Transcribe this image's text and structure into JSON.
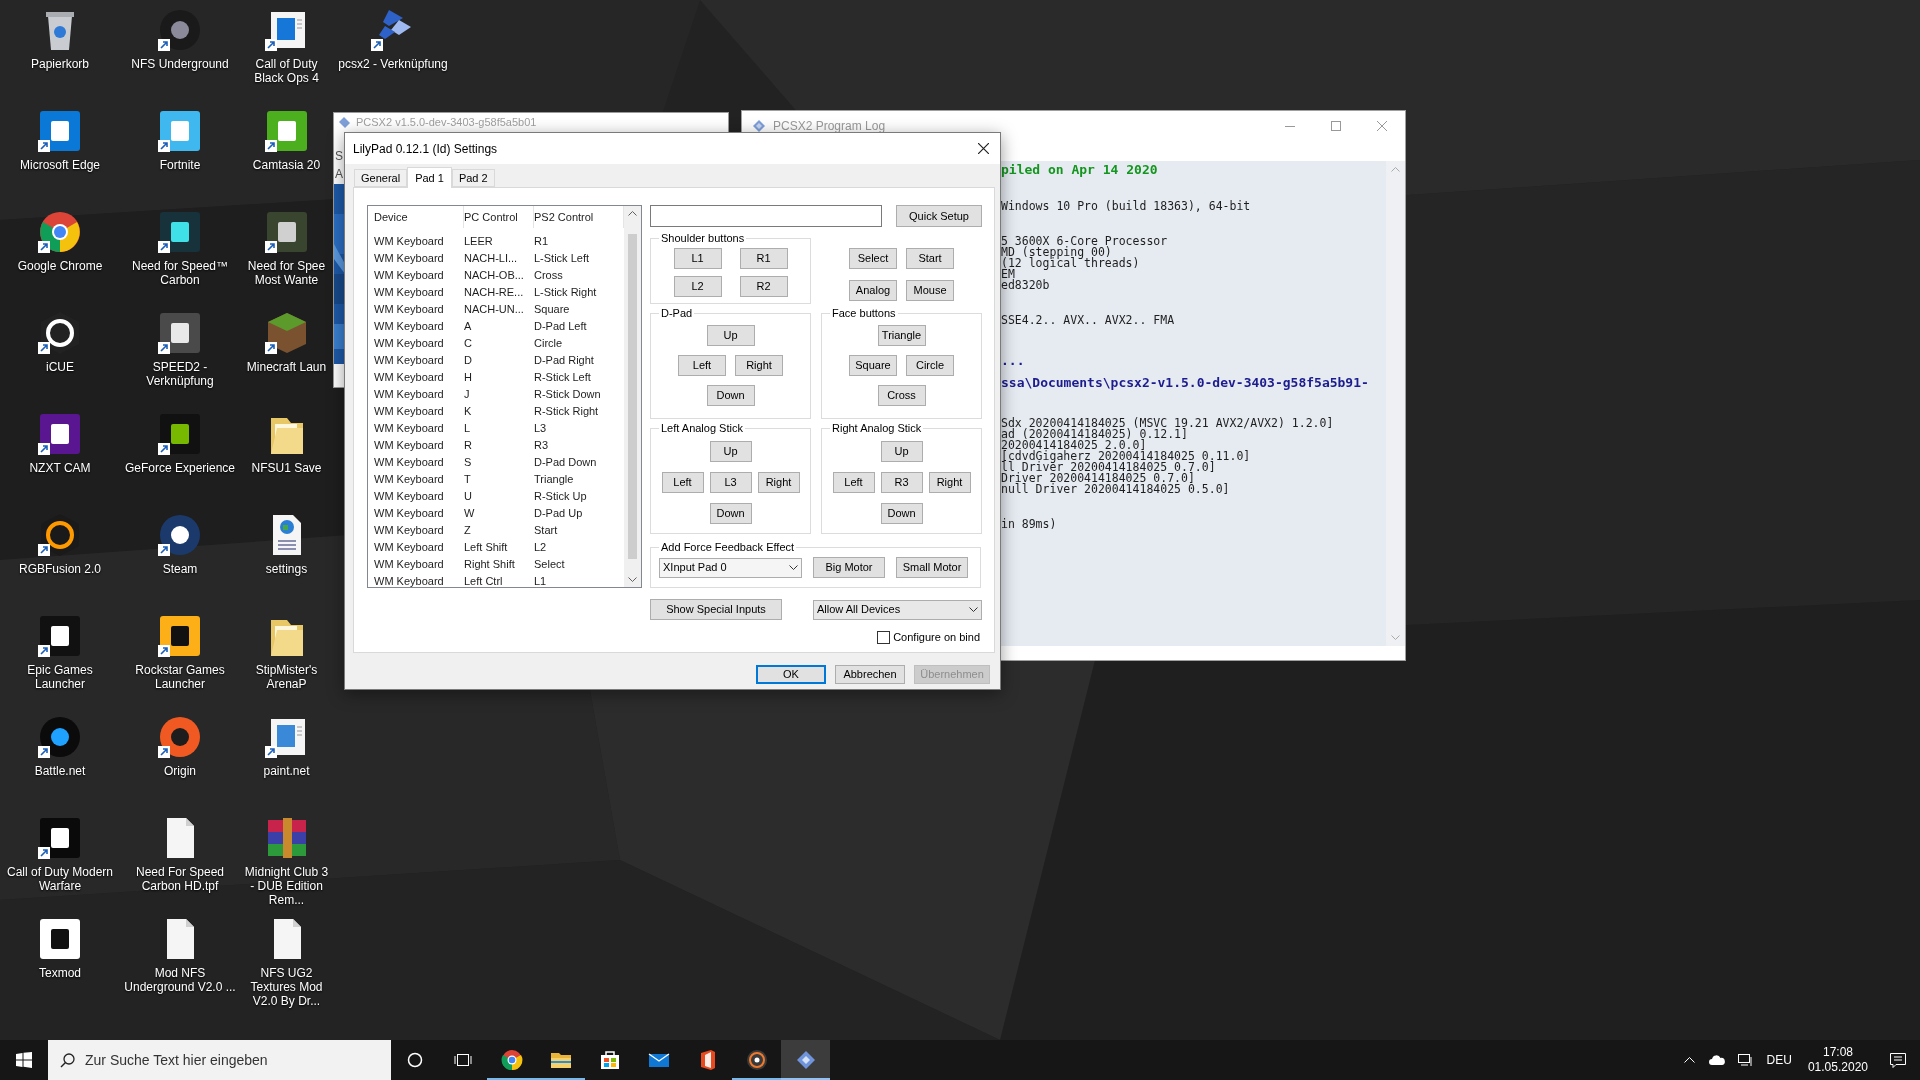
{
  "desktop": {
    "icons": [
      {
        "label": "Papierkorb"
      },
      {
        "label": "Microsoft Edge"
      },
      {
        "label": "Google Chrome"
      },
      {
        "label": "iCUE"
      },
      {
        "label": "NZXT CAM"
      },
      {
        "label": "RGBFusion 2.0"
      },
      {
        "label": "Epic Games Launcher"
      },
      {
        "label": "Battle.net"
      },
      {
        "label": "Call of Duty Modern Warfare"
      },
      {
        "label": "Texmod"
      },
      {
        "label": "NFS Underground"
      },
      {
        "label": "Fortnite"
      },
      {
        "label": "Need for Speed™ Carbon"
      },
      {
        "label": "SPEED2 - Verknüpfung"
      },
      {
        "label": "GeForce Experience"
      },
      {
        "label": "Steam"
      },
      {
        "label": "Rockstar Games Launcher"
      },
      {
        "label": "Origin"
      },
      {
        "label": "Need For Speed Carbon HD.tpf"
      },
      {
        "label": "Mod NFS Underground V2.0 ..."
      },
      {
        "label": "Call of Duty Black Ops 4"
      },
      {
        "label": "Camtasia 20"
      },
      {
        "label": "Need for Spee Most Wante"
      },
      {
        "label": "Minecraft Laun"
      },
      {
        "label": "NFSU1 Save"
      },
      {
        "label": "settings"
      },
      {
        "label": "StipMister's ArenaP"
      },
      {
        "label": "paint.net"
      },
      {
        "label": "Midnight Club 3 - DUB Edition Rem..."
      },
      {
        "label": "NFS UG2 Textures Mod V2.0 By Dr..."
      },
      {
        "label": "pcsx2 - Verknüpfung"
      }
    ]
  },
  "main_window": {
    "title": "PCSX2 v1.5.0-dev-3403-g58f5a5b01",
    "fragments": [
      "S",
      "A"
    ]
  },
  "log_window": {
    "title": "PCSX2 Program Log",
    "blocks": [
      {
        "kind": "highlight",
        "lines": [
          "piled on Apr 14 2020"
        ]
      },
      {
        "kind": "plain",
        "lines": [
          "Windows 10 Pro (build 18363), 64-bit"
        ]
      },
      {
        "kind": "plain",
        "lines": [
          "5 3600X 6-Core Processor",
          "MD (stepping 00)",
          "(12 logical threads)",
          "EM",
          "ed8320b"
        ]
      },
      {
        "kind": "plain",
        "lines": [
          "SSE4.2.. AVX.. AVX2.. FMA"
        ]
      },
      {
        "kind": "section",
        "lines": [
          "...",
          "ssa\\Documents\\pcsx2-v1.5.0-dev-3403-g58f5a5b91-"
        ]
      },
      {
        "kind": "plain",
        "lines": [
          "Sdx 20200414184025 (MSVC 19.21 AVX2/AVX2) 1.2.0]",
          "ad (20200414184025) 0.12.1]",
          "20200414184025 2.0.0]",
          "[cdvdGigaherz 20200414184025 0.11.0]",
          "ll Driver 20200414184025 0.7.0]",
          "Driver 20200414184025 0.7.0]",
          "null Driver 20200414184025 0.5.0]"
        ]
      },
      {
        "kind": "plain",
        "lines": [
          "in 89ms)"
        ]
      }
    ]
  },
  "dialog": {
    "title": "LilyPad 0.12.1 (Id) Settings",
    "tabs": [
      {
        "label": "General",
        "selected": false
      },
      {
        "label": "Pad 1",
        "selected": true
      },
      {
        "label": "Pad 2",
        "selected": false
      }
    ],
    "bindings": {
      "columns": [
        "Device",
        "PC Control",
        "PS2 Control"
      ],
      "rows": [
        [
          "WM Keyboard",
          "LEER",
          "R1"
        ],
        [
          "WM Keyboard",
          "NACH-LI...",
          "L-Stick Left"
        ],
        [
          "WM Keyboard",
          "NACH-OB...",
          "Cross"
        ],
        [
          "WM Keyboard",
          "NACH-RE...",
          "L-Stick Right"
        ],
        [
          "WM Keyboard",
          "NACH-UN...",
          "Square"
        ],
        [
          "WM Keyboard",
          "A",
          "D-Pad Left"
        ],
        [
          "WM Keyboard",
          "C",
          "Circle"
        ],
        [
          "WM Keyboard",
          "D",
          "D-Pad Right"
        ],
        [
          "WM Keyboard",
          "H",
          "R-Stick Left"
        ],
        [
          "WM Keyboard",
          "J",
          "R-Stick Down"
        ],
        [
          "WM Keyboard",
          "K",
          "R-Stick Right"
        ],
        [
          "WM Keyboard",
          "L",
          "L3"
        ],
        [
          "WM Keyboard",
          "R",
          "R3"
        ],
        [
          "WM Keyboard",
          "S",
          "D-Pad Down"
        ],
        [
          "WM Keyboard",
          "T",
          "Triangle"
        ],
        [
          "WM Keyboard",
          "U",
          "R-Stick Up"
        ],
        [
          "WM Keyboard",
          "W",
          "D-Pad Up"
        ],
        [
          "WM Keyboard",
          "Z",
          "Start"
        ],
        [
          "WM Keyboard",
          "Left Shift",
          "L2"
        ],
        [
          "WM Keyboard",
          "Right Shift",
          "Select"
        ],
        [
          "WM Keyboard",
          "Left Ctrl",
          "L1"
        ]
      ]
    },
    "quick_setup": "Quick Setup",
    "shoulder": {
      "title": "Shoulder buttons",
      "buttons": [
        "L1",
        "R1",
        "L2",
        "R2"
      ]
    },
    "misc_buttons": [
      "Select",
      "Start",
      "Analog",
      "Mouse"
    ],
    "pads": [
      {
        "kind": "dpad",
        "title": "D-Pad",
        "buttons": [
          "Up",
          "Left",
          "Right",
          "Down"
        ]
      },
      {
        "kind": "dpad",
        "title": "Face buttons",
        "buttons": [
          "Triangle",
          "Square",
          "Circle",
          "Cross"
        ]
      },
      {
        "kind": "stick",
        "title": "Left Analog Stick",
        "buttons": [
          "Up",
          "Left",
          "L3",
          "Right",
          "Down"
        ]
      },
      {
        "kind": "stick",
        "title": "Right Analog Stick",
        "buttons": [
          "Up",
          "Left",
          "R3",
          "Right",
          "Down"
        ]
      }
    ],
    "force_feedback": {
      "title": "Add Force Feedback Effect",
      "device": "XInput Pad 0",
      "buttons": [
        "Big Motor",
        "Small Motor"
      ]
    },
    "special_inputs": "Show Special Inputs",
    "device_filter": "Allow All Devices",
    "configure_on_bind": {
      "label": "Configure on bind",
      "checked": false
    },
    "footer": [
      {
        "label": "OK",
        "default": true,
        "disabled": false
      },
      {
        "label": "Abbrechen",
        "default": false,
        "disabled": false
      },
      {
        "label": "Übernehmen",
        "default": false,
        "disabled": true
      }
    ]
  },
  "taskbar": {
    "search_placeholder": "Zur Suche Text hier eingeben",
    "apps": [
      {
        "running": true,
        "selected": false
      },
      {
        "running": true,
        "selected": false
      },
      {
        "running": false,
        "selected": false
      },
      {
        "running": false,
        "selected": false
      },
      {
        "running": false,
        "selected": false
      },
      {
        "running": true,
        "selected": false
      },
      {
        "running": true,
        "selected": true
      }
    ],
    "language": "DEU",
    "time": "17:08",
    "date": "01.05.2020"
  }
}
